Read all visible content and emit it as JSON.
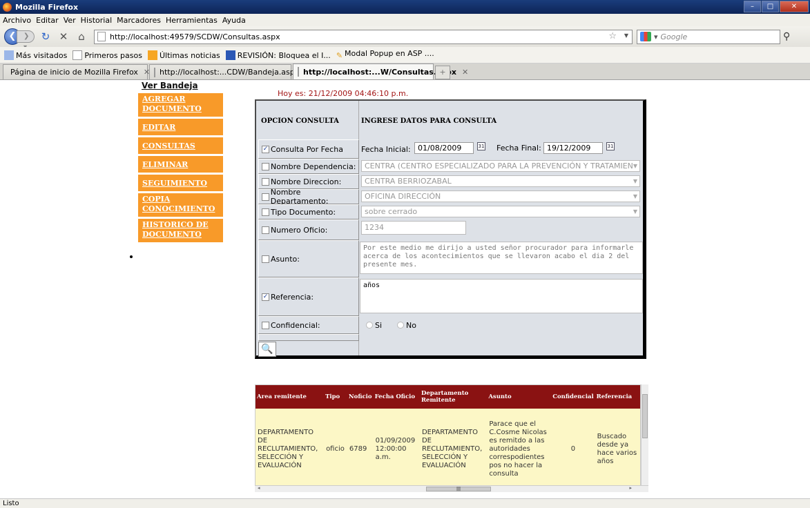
{
  "window": {
    "title": "Mozilla Firefox"
  },
  "menu": [
    "Archivo",
    "Editar",
    "Ver",
    "Historial",
    "Marcadores",
    "Herramientas",
    "Ayuda"
  ],
  "nav": {
    "url": "http://localhost:49579/SCDW/Consultas.aspx",
    "search_placeholder": "Google"
  },
  "bookmarks": [
    "Más visitados",
    "Primeros pasos",
    "Últimas noticias",
    "REVISIÓN: Bloquea el I...",
    "Modal Popup en ASP ...."
  ],
  "tabs": [
    {
      "label": "Página de inicio de Mozilla Firefox",
      "active": false
    },
    {
      "label": "http://localhost:...CDW/Bandeja.aspx",
      "active": false
    },
    {
      "label": "http://localhost:...W/Consultas.aspx",
      "active": true
    }
  ],
  "page": {
    "ver_bandeja": "Ver Bandeja",
    "hoy": "Hoy es: 21/12/2009 04:46:10 p.m.",
    "menu": [
      "AGREGAR DOCUMENTO",
      "EDITAR",
      "CONSULTAS",
      "ELIMINAR",
      "SEGUIMIENTO",
      "COPIA CONOCIMIENTO",
      "HISTORICO DE DOCUMENTO"
    ]
  },
  "form": {
    "header_left": "OPCION CONSULTA",
    "header_right": "INGRESE DATOS PARA CONSULTA",
    "rows": {
      "fecha": {
        "label": "Consulta Por Fecha",
        "checked": true,
        "fecha_inicial_label": "Fecha Inicial:",
        "fecha_inicial": "01/08/2009",
        "fecha_final_label": "Fecha Final:",
        "fecha_final": "19/12/2009"
      },
      "dependencia": {
        "label": "Nombre Dependencia:",
        "checked": false,
        "value": "CENTRA (CENTRO ESPECIALIZADO PARA LA PREVENCIÓN Y TRATAMIEN"
      },
      "direccion": {
        "label": "Nombre Direccion:",
        "checked": false,
        "value": "CENTRA BERRIOZABAL"
      },
      "departamento": {
        "label": "Nombre Departamento:",
        "checked": false,
        "value": "OFICINA DIRECCIÓN"
      },
      "tipo": {
        "label": "Tipo Documento:",
        "checked": false,
        "value": "sobre cerrado"
      },
      "oficio": {
        "label": "Numero Oficio:",
        "checked": false,
        "value": "1234"
      },
      "asunto": {
        "label": "Asunto:",
        "checked": false,
        "value": "Por este medio me dirijo a usted señor procurador para informarle acerca de los acontecimientos que se llevaron acabo el dia 2 del presente mes."
      },
      "referencia": {
        "label": "Referencia:",
        "checked": true,
        "value": "años"
      },
      "confidencial": {
        "label": "Confidencial:",
        "checked": false,
        "si": "Si",
        "no": "No"
      }
    },
    "calendar_icon": "calendar-icon",
    "search_icon": "magnifier-icon"
  },
  "grid": {
    "columns": [
      "Area remitente",
      "Tipo",
      "Noficio",
      "Fecha Oficio",
      "Departamento Remitente",
      "Asunto",
      "Confidencial",
      "Referencia"
    ],
    "rows": [
      [
        "DEPARTAMENTO DE RECLUTAMIENTO, SELECCIÓN Y EVALUACIÓN",
        "oficio",
        "6789",
        "01/09/2009 12:00:00 a.m.",
        "DEPARTAMENTO DE RECLUTAMIENTO, SELECCIÓN Y EVALUACIÓN",
        "Parace que el C.Cosme Nicolas es remitdo a las autoridades correspodientes pos no hacer la consulta",
        "0",
        "Buscado desde ya hace varios años"
      ]
    ]
  },
  "status": "Listo"
}
